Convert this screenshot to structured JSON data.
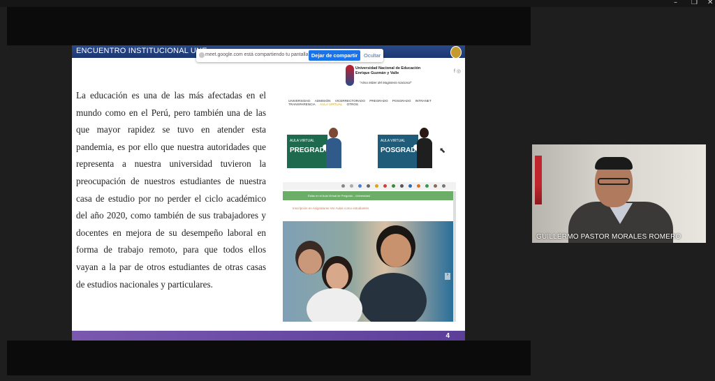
{
  "window": {
    "minimize": "–",
    "maximize": "❐",
    "close": "✕"
  },
  "slide": {
    "title": "ENCUENTRO INSTITUCIONAL UNE",
    "body": "La educación es una de las más afectadas en el mundo como en el Perú, pero también una de las que mayor rapidez se tuvo en atender esta pandemia, es por ello que nuestra autoridades que representa a nuestra universidad  tuvieron la preocupación  de nuestros estudiantes de nuestra casa de estudio por no perder el ciclo académico del año 2020, como también de sus trabajadores y docentes en mejora de su desempeño laboral en forma de trabajo remoto, para que todos ellos vayan a la par de otros estudiantes de otras casas de estudios nacionales y particulares.",
    "page_number": "4"
  },
  "share_bar": {
    "text": "meet.google.com está compartiendo tu pantalla.",
    "stop_label": "Dejar de compartir",
    "hide_label": "Ocultar"
  },
  "website": {
    "uni_name_line1": "Universidad Nacional de Educación",
    "uni_name_line2": "Enrique Guzmán y Valle",
    "motto": "\"Alma Máter del Magisterio Nacional\"",
    "social": "f ◎",
    "nav": [
      "UNIVERSIDAD",
      "ADMISIÓN",
      "VICERRECTORADO",
      "PREGRADO",
      "POSGRADO",
      "INTRANET",
      "TRANSPARENCIA",
      "AULA VIRTUAL",
      "OTROS"
    ],
    "aula_pregrado": {
      "small": "AULA VIRTUAL",
      "big": "PREGRADO"
    },
    "aula_posgrado": {
      "small": "AULA VIRTUAL",
      "big": "POSGRADO"
    },
    "green_banner": "Estás en el Aula Virtual de Pregrado - Universidad",
    "links": "Inscripción en Asignaturas        Ver Aulas como estudiantes"
  },
  "participant": {
    "name": "GUILLERMO PASTOR MORALES ROMERO"
  },
  "colors": {
    "slide_header": "#1c3872",
    "slide_footer": "#5b3f98",
    "share_button": "#1a73e8",
    "pregrado_box": "#1e6a4f",
    "posgrado_box": "#1e5c7a"
  }
}
